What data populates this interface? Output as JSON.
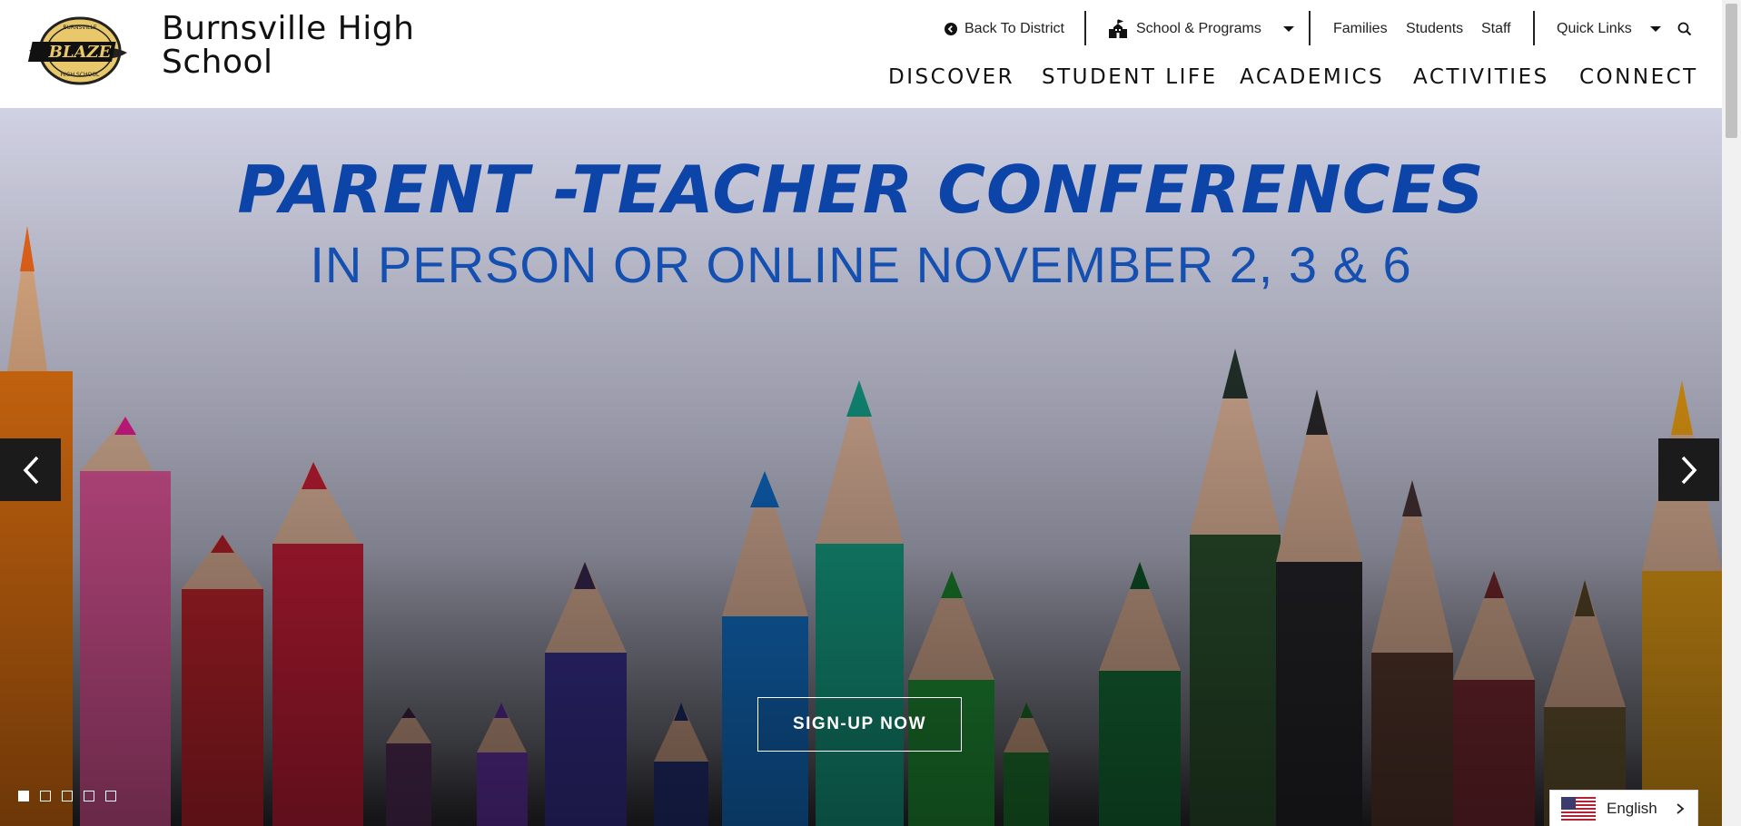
{
  "header": {
    "school_name_line1": "Burnsville High",
    "school_name_line2": "School",
    "logo_alt": "Burnsville Blaze High School logo",
    "utility": {
      "back_to_district": "Back To District",
      "school_programs": "School & Programs",
      "families": "Families",
      "students": "Students",
      "staff": "Staff",
      "quick_links": "Quick Links"
    },
    "nav": [
      "DISCOVER",
      "STUDENT LIFE",
      "ACADEMICS",
      "ACTIVITIES",
      "CONNECT"
    ]
  },
  "hero": {
    "title": "PARENT -TEACHER CONFERENCES",
    "subtitle": "IN PERSON OR ONLINE NOVEMBER 2, 3 & 6",
    "cta_label": "SIGN-UP NOW",
    "slide_count": 5,
    "active_slide": 1
  },
  "language": {
    "selected": "English"
  },
  "icons": {
    "back": "back-circle-icon",
    "school": "school-building-icon",
    "caret": "caret-down-icon",
    "search": "search-icon",
    "prev": "chevron-left-icon",
    "next": "chevron-right-icon",
    "flag": "us-flag-icon"
  },
  "colors": {
    "title_blue": "#0c44a8",
    "arrow_bg": "#1b1b1b",
    "logo_gold": "#e8c86a"
  }
}
